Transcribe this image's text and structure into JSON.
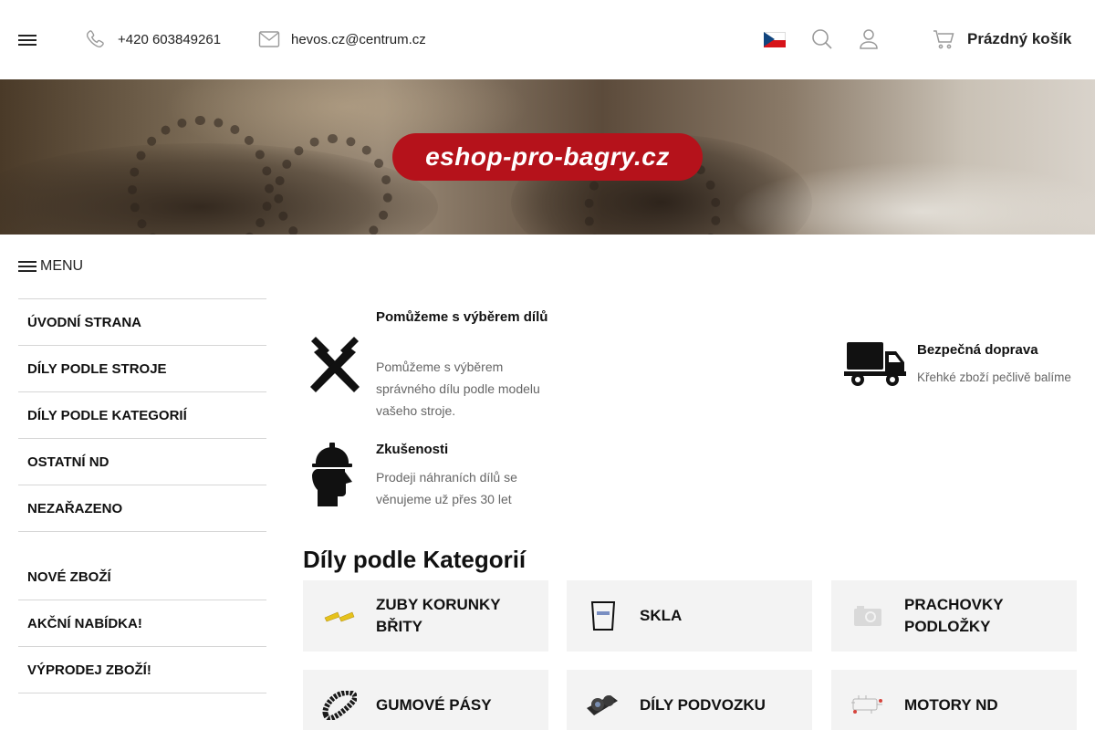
{
  "header": {
    "phone": "+420 603849261",
    "email": "hevos.cz@centrum.cz",
    "cart_label": "Prázdný košík",
    "language": "cs",
    "icons": [
      "menu-icon",
      "phone-icon",
      "mail-icon",
      "flag-cz-icon",
      "search-icon",
      "user-icon",
      "cart-icon"
    ]
  },
  "banner": {
    "logo_text": "eshop-pro-bagry.cz",
    "logo_color": "#b5121b"
  },
  "sidebar": {
    "menu_label": "MENU",
    "primary": [
      {
        "label": "ÚVODNÍ STRANA"
      },
      {
        "label": "DÍLY PODLE STROJE"
      },
      {
        "label": "DÍLY PODLE KATEGORIÍ"
      },
      {
        "label": "OSTATNÍ ND"
      },
      {
        "label": "NEZAŘAZENO"
      }
    ],
    "secondary": [
      {
        "label": "NOVÉ ZBOŽÍ"
      },
      {
        "label": "AKČNÍ NABÍDKA!"
      },
      {
        "label": "VÝPRODEJ ZBOŽÍ!"
      }
    ]
  },
  "benefits": [
    {
      "icon": "hammers-icon",
      "title": "Pomůžeme s výběrem dílů",
      "text": "Pomůžeme s výběrem správného dílu podle modelu vašeho stroje."
    },
    {
      "icon": "truck-icon",
      "title": "Bezpečná doprava",
      "text": "Křehké zboží pečlivě balíme"
    },
    {
      "icon": "worker-icon",
      "title": "Zkušenosti",
      "text": "Prodeji náhraních dílů se věnujeme už přes 30 let"
    }
  ],
  "categories": {
    "title": "Díly podle Kategorií",
    "items": [
      {
        "label": "ZUBY KORUNKY BŘITY",
        "thumb": "teeth-thumb"
      },
      {
        "label": "SKLA",
        "thumb": "glass-thumb"
      },
      {
        "label": "PRACHOVKY PODLOŽKY",
        "thumb": "placeholder-thumb"
      },
      {
        "label": "GUMOVÉ PÁSY",
        "thumb": "track-thumb"
      },
      {
        "label": "DÍLY PODVOZKU",
        "thumb": "roller-thumb"
      },
      {
        "label": "MOTORY ND",
        "thumb": "engine-thumb"
      }
    ]
  }
}
